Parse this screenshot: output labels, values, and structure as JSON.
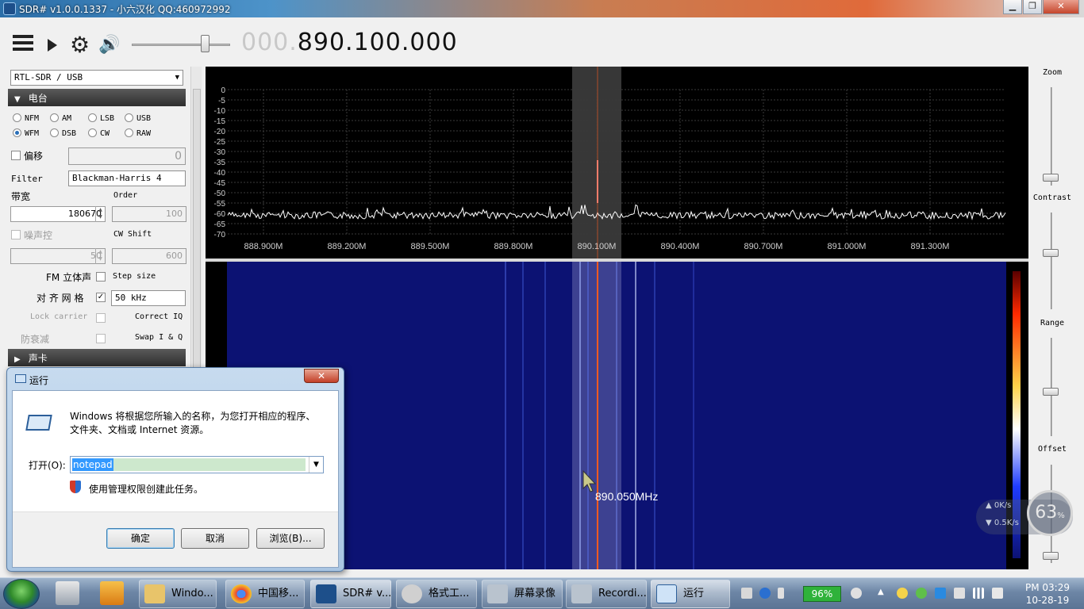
{
  "window": {
    "title": "SDR# v1.0.0.1337 - 小六汉化 QQ:460972992",
    "min": "▁",
    "max": "❐",
    "close": "✕"
  },
  "toolbar": {
    "frequency_dim": "000.",
    "frequency_main": "890.100.000",
    "icons": [
      "menu-icon",
      "play-icon",
      "gear-icon",
      "speaker-icon"
    ]
  },
  "source": {
    "device": "RTL-SDR / USB"
  },
  "radio": {
    "section_title": "电台",
    "modes": [
      "NFM",
      "AM",
      "LSB",
      "USB",
      "WFM",
      "DSB",
      "CW",
      "RAW"
    ],
    "selected_mode": "WFM",
    "offset_label": "偏移",
    "offset_value": "0",
    "filter_label": "Filter",
    "filter_value": "Blackman-Harris 4",
    "bandwidth_label": "带宽",
    "bandwidth_value": "180670",
    "order_label": "Order",
    "order_value": "100",
    "squelch_label": "噪声控",
    "squelch_value": "50",
    "cwshift_label": "CW Shift",
    "cwshift_value": "600",
    "fm_stereo_label": "FM 立体声",
    "step_size_label": "Step size",
    "snap_label": "对 齐 网 格",
    "snap_value": "50 kHz",
    "lock_carrier_label": "Lock carrier",
    "correct_iq_label": "Correct IQ",
    "anti_fading_label": "防衰减",
    "swap_iq_label": "Swap I & Q",
    "audio_section_title": "声卡"
  },
  "spectrum": {
    "y_ticks": [
      "0",
      "-5",
      "-10",
      "-15",
      "-20",
      "-25",
      "-30",
      "-35",
      "-40",
      "-45",
      "-50",
      "-55",
      "-60",
      "-65",
      "-70"
    ],
    "x_ticks": [
      "888.900M",
      "889.200M",
      "889.500M",
      "889.800M",
      "890.100M",
      "890.400M",
      "890.700M",
      "891.000M",
      "891.300M"
    ],
    "cursor_label": "890.050MHz"
  },
  "right_panel": {
    "zoom": "Zoom",
    "contrast": "Contrast",
    "range": "Range",
    "offset": "Offset"
  },
  "run_dialog": {
    "title": "运行",
    "description": "Windows 将根据您所输入的名称，为您打开相应的程序、文件夹、文档或 Internet 资源。",
    "open_label": "打开(O):",
    "input_value": "notepad",
    "admin_note": "使用管理权限创建此任务。",
    "ok": "确定",
    "cancel": "取消",
    "browse": "浏览(B)..."
  },
  "net_widget": {
    "percent": "63",
    "up": "0K/s",
    "down": "0.5K/s"
  },
  "taskbar": {
    "items": [
      "Windo...",
      "中国移...",
      "SDR# v...",
      "格式工...",
      "屏幕录像",
      "Recordi...",
      "运行"
    ],
    "battery": "96%",
    "time": "PM 03:29",
    "date": "10-28-19"
  },
  "colors": {
    "waterfall_bg": "#0c1273",
    "spectrum_bg": "#000000",
    "center_line": "#ff5a1f",
    "highlight_band": "#e0e0e0"
  }
}
